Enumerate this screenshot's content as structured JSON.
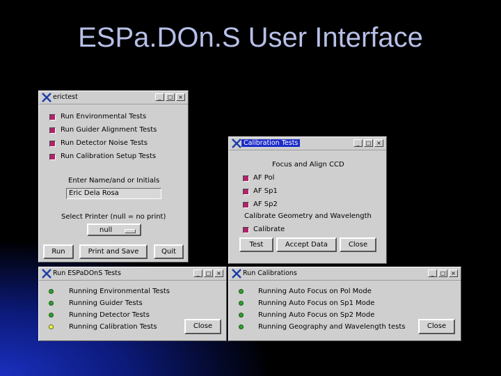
{
  "slide": {
    "title": "ESPa.DOn.S User Interface"
  },
  "colors": {
    "checkbox": "#b0246a",
    "led_green": "#2ea02e",
    "led_yellow": "#f2f24a",
    "active_title": "#1c2cc8"
  },
  "window_controls": {
    "minimize": "_",
    "maximize": "□",
    "close": "×"
  },
  "ericktest": {
    "title": "erictest",
    "checks": [
      "Run Environmental Tests",
      "Run Guider Alignment Tests",
      "Run Detector Noise Tests",
      "Run Calibration Setup Tests"
    ],
    "name_label": "Enter Name/and or Initials",
    "name_value": "Eric Dela Rosa",
    "printer_label": "Select Printer (null = no print)",
    "printer_value": "null",
    "buttons": {
      "run": "Run",
      "print_save": "Print and Save",
      "quit": "Quit"
    }
  },
  "calibration_tests": {
    "title": "Calibration Tests",
    "section1": "Focus and Align CCD",
    "checks": [
      "AF Pol",
      "AF Sp1",
      "AF Sp2"
    ],
    "section2": "Calibrate Geometry and Wavelength",
    "calibrate": "Calibrate",
    "buttons": {
      "test": "Test",
      "accept": "Accept Data",
      "close": "Close"
    }
  },
  "run_espadons": {
    "title": "Run ESPaDOnS Tests",
    "items": [
      {
        "label": "Running Environmental Tests",
        "status": "green"
      },
      {
        "label": "Running Guider Tests",
        "status": "green"
      },
      {
        "label": "Running Detector Tests",
        "status": "green"
      },
      {
        "label": "Running Calibration Tests",
        "status": "yellow"
      }
    ],
    "close": "Close"
  },
  "run_calibrations": {
    "title": "Run Calibrations",
    "items": [
      {
        "label": "Running Auto Focus on Pol Mode",
        "status": "green"
      },
      {
        "label": "Running Auto Focus on Sp1 Mode",
        "status": "green"
      },
      {
        "label": "Running Auto Focus on Sp2 Mode",
        "status": "green"
      },
      {
        "label": "Running Geography and Wavelength tests",
        "status": "green"
      }
    ],
    "close": "Close"
  }
}
